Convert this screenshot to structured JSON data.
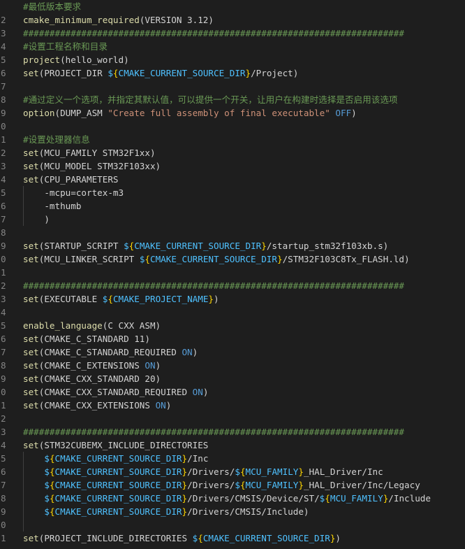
{
  "editor": {
    "colors": {
      "background": "#1e1e1e",
      "comment": "#6a9955",
      "function": "#dcdcaa",
      "default": "#d4d4d4",
      "string": "#ce9178",
      "variable": "#4fc1ff",
      "keyword": "#569cd6",
      "brace": "#ffd700",
      "line_number": "#858585"
    },
    "lines": [
      {
        "num": "",
        "tokens": [
          [
            "comment",
            "#最低版本要求"
          ]
        ]
      },
      {
        "num": "2",
        "tokens": [
          [
            "func",
            "cmake_minimum_required"
          ],
          [
            "default",
            "(VERSION 3.12)"
          ]
        ]
      },
      {
        "num": "3",
        "tokens": [
          [
            "comment",
            "########################################################################"
          ]
        ]
      },
      {
        "num": "4",
        "tokens": [
          [
            "comment",
            "#设置工程名称和目录"
          ]
        ]
      },
      {
        "num": "5",
        "tokens": [
          [
            "func",
            "project"
          ],
          [
            "default",
            "(hello_world)"
          ]
        ]
      },
      {
        "num": "6",
        "tokens": [
          [
            "func",
            "set"
          ],
          [
            "default",
            "(PROJECT_DIR "
          ],
          [
            "var",
            "$"
          ],
          [
            "brace",
            "{"
          ],
          [
            "vname",
            "CMAKE_CURRENT_SOURCE_DIR"
          ],
          [
            "brace",
            "}"
          ],
          [
            "default",
            "/Project)"
          ]
        ]
      },
      {
        "num": "7",
        "tokens": []
      },
      {
        "num": "8",
        "tokens": [
          [
            "comment",
            "#通过定义一个选项，并指定其默认值，可以提供一个开关，让用户在构建时选择是否启用该选项"
          ]
        ]
      },
      {
        "num": "9",
        "tokens": [
          [
            "func",
            "option"
          ],
          [
            "default",
            "(DUMP_ASM "
          ],
          [
            "string",
            "\"Create full assembly of final executable\""
          ],
          [
            "default",
            " "
          ],
          [
            "kw",
            "OFF"
          ],
          [
            "default",
            ")"
          ]
        ]
      },
      {
        "num": "0",
        "tokens": []
      },
      {
        "num": "1",
        "tokens": [
          [
            "comment",
            "#设置处理器信息"
          ]
        ]
      },
      {
        "num": "2",
        "tokens": [
          [
            "func",
            "set"
          ],
          [
            "default",
            "(MCU_FAMILY STM32F1xx)"
          ]
        ]
      },
      {
        "num": "3",
        "tokens": [
          [
            "func",
            "set"
          ],
          [
            "default",
            "(MCU_MODEL STM32F103xx)"
          ]
        ]
      },
      {
        "num": "4",
        "tokens": [
          [
            "func",
            "set"
          ],
          [
            "default",
            "(CPU_PARAMETERS"
          ]
        ]
      },
      {
        "num": "5",
        "tokens": [
          [
            "default",
            "    -mcpu=cortex-m3"
          ]
        ]
      },
      {
        "num": "6",
        "tokens": [
          [
            "default",
            "    -mthumb"
          ]
        ]
      },
      {
        "num": "7",
        "tokens": [
          [
            "default",
            "    )"
          ]
        ]
      },
      {
        "num": "8",
        "tokens": []
      },
      {
        "num": "9",
        "tokens": [
          [
            "func",
            "set"
          ],
          [
            "default",
            "(STARTUP_SCRIPT "
          ],
          [
            "var",
            "$"
          ],
          [
            "brace",
            "{"
          ],
          [
            "vname",
            "CMAKE_CURRENT_SOURCE_DIR"
          ],
          [
            "brace",
            "}"
          ],
          [
            "default",
            "/startup_stm32f103xb.s)"
          ]
        ]
      },
      {
        "num": "0",
        "tokens": [
          [
            "func",
            "set"
          ],
          [
            "default",
            "(MCU_LINKER_SCRIPT "
          ],
          [
            "var",
            "$"
          ],
          [
            "brace",
            "{"
          ],
          [
            "vname",
            "CMAKE_CURRENT_SOURCE_DIR"
          ],
          [
            "brace",
            "}"
          ],
          [
            "default",
            "/STM32F103C8Tx_FLASH.ld)"
          ]
        ]
      },
      {
        "num": "1",
        "tokens": []
      },
      {
        "num": "2",
        "tokens": [
          [
            "comment",
            "########################################################################"
          ]
        ]
      },
      {
        "num": "3",
        "tokens": [
          [
            "func",
            "set"
          ],
          [
            "default",
            "(EXECUTABLE "
          ],
          [
            "var",
            "$"
          ],
          [
            "brace",
            "{"
          ],
          [
            "vname",
            "CMAKE_PROJECT_NAME"
          ],
          [
            "brace",
            "}"
          ],
          [
            "default",
            ")"
          ]
        ]
      },
      {
        "num": "4",
        "tokens": []
      },
      {
        "num": "5",
        "tokens": [
          [
            "func",
            "enable_language"
          ],
          [
            "default",
            "(C CXX ASM)"
          ]
        ]
      },
      {
        "num": "6",
        "tokens": [
          [
            "func",
            "set"
          ],
          [
            "default",
            "(CMAKE_C_STANDARD 11)"
          ]
        ]
      },
      {
        "num": "7",
        "tokens": [
          [
            "func",
            "set"
          ],
          [
            "default",
            "(CMAKE_C_STANDARD_REQUIRED "
          ],
          [
            "kw",
            "ON"
          ],
          [
            "default",
            ")"
          ]
        ]
      },
      {
        "num": "8",
        "tokens": [
          [
            "func",
            "set"
          ],
          [
            "default",
            "(CMAKE_C_EXTENSIONS "
          ],
          [
            "kw",
            "ON"
          ],
          [
            "default",
            ")"
          ]
        ]
      },
      {
        "num": "9",
        "tokens": [
          [
            "func",
            "set"
          ],
          [
            "default",
            "(CMAKE_CXX_STANDARD 20)"
          ]
        ]
      },
      {
        "num": "0",
        "tokens": [
          [
            "func",
            "set"
          ],
          [
            "default",
            "(CMAKE_CXX_STANDARD_REQUIRED "
          ],
          [
            "kw",
            "ON"
          ],
          [
            "default",
            ")"
          ]
        ]
      },
      {
        "num": "1",
        "tokens": [
          [
            "func",
            "set"
          ],
          [
            "default",
            "(CMAKE_CXX_EXTENSIONS "
          ],
          [
            "kw",
            "ON"
          ],
          [
            "default",
            ")"
          ]
        ]
      },
      {
        "num": "2",
        "tokens": []
      },
      {
        "num": "3",
        "tokens": [
          [
            "comment",
            "########################################################################"
          ]
        ]
      },
      {
        "num": "4",
        "tokens": [
          [
            "func",
            "set"
          ],
          [
            "default",
            "(STM32CUBEMX_INCLUDE_DIRECTORIES"
          ]
        ]
      },
      {
        "num": "5",
        "tokens": [
          [
            "default",
            "    "
          ],
          [
            "var",
            "$"
          ],
          [
            "brace",
            "{"
          ],
          [
            "vname",
            "CMAKE_CURRENT_SOURCE_DIR"
          ],
          [
            "brace",
            "}"
          ],
          [
            "default",
            "/Inc"
          ]
        ]
      },
      {
        "num": "6",
        "tokens": [
          [
            "default",
            "    "
          ],
          [
            "var",
            "$"
          ],
          [
            "brace",
            "{"
          ],
          [
            "vname",
            "CMAKE_CURRENT_SOURCE_DIR"
          ],
          [
            "brace",
            "}"
          ],
          [
            "default",
            "/Drivers/"
          ],
          [
            "var",
            "$"
          ],
          [
            "brace",
            "{"
          ],
          [
            "vname",
            "MCU_FAMILY"
          ],
          [
            "brace",
            "}"
          ],
          [
            "default",
            "_HAL_Driver/Inc"
          ]
        ]
      },
      {
        "num": "7",
        "tokens": [
          [
            "default",
            "    "
          ],
          [
            "var",
            "$"
          ],
          [
            "brace",
            "{"
          ],
          [
            "vname",
            "CMAKE_CURRENT_SOURCE_DIR"
          ],
          [
            "brace",
            "}"
          ],
          [
            "default",
            "/Drivers/"
          ],
          [
            "var",
            "$"
          ],
          [
            "brace",
            "{"
          ],
          [
            "vname",
            "MCU_FAMILY"
          ],
          [
            "brace",
            "}"
          ],
          [
            "default",
            "_HAL_Driver/Inc/Legacy"
          ]
        ]
      },
      {
        "num": "8",
        "tokens": [
          [
            "default",
            "    "
          ],
          [
            "var",
            "$"
          ],
          [
            "brace",
            "{"
          ],
          [
            "vname",
            "CMAKE_CURRENT_SOURCE_DIR"
          ],
          [
            "brace",
            "}"
          ],
          [
            "default",
            "/Drivers/CMSIS/Device/ST/"
          ],
          [
            "var",
            "$"
          ],
          [
            "brace",
            "{"
          ],
          [
            "vname",
            "MCU_FAMILY"
          ],
          [
            "brace",
            "}"
          ],
          [
            "default",
            "/Include"
          ]
        ]
      },
      {
        "num": "9",
        "tokens": [
          [
            "default",
            "    "
          ],
          [
            "var",
            "$"
          ],
          [
            "brace",
            "{"
          ],
          [
            "vname",
            "CMAKE_CURRENT_SOURCE_DIR"
          ],
          [
            "brace",
            "}"
          ],
          [
            "default",
            "/Drivers/CMSIS/Include)"
          ]
        ]
      },
      {
        "num": "0",
        "tokens": []
      },
      {
        "num": "1",
        "tokens": [
          [
            "func",
            "set"
          ],
          [
            "default",
            "(PROJECT_INCLUDE_DIRECTORIES "
          ],
          [
            "var",
            "$"
          ],
          [
            "brace",
            "{"
          ],
          [
            "vname",
            "CMAKE_CURRENT_SOURCE_DIR"
          ],
          [
            "brace",
            "}"
          ],
          [
            "default",
            ")"
          ]
        ]
      }
    ]
  }
}
